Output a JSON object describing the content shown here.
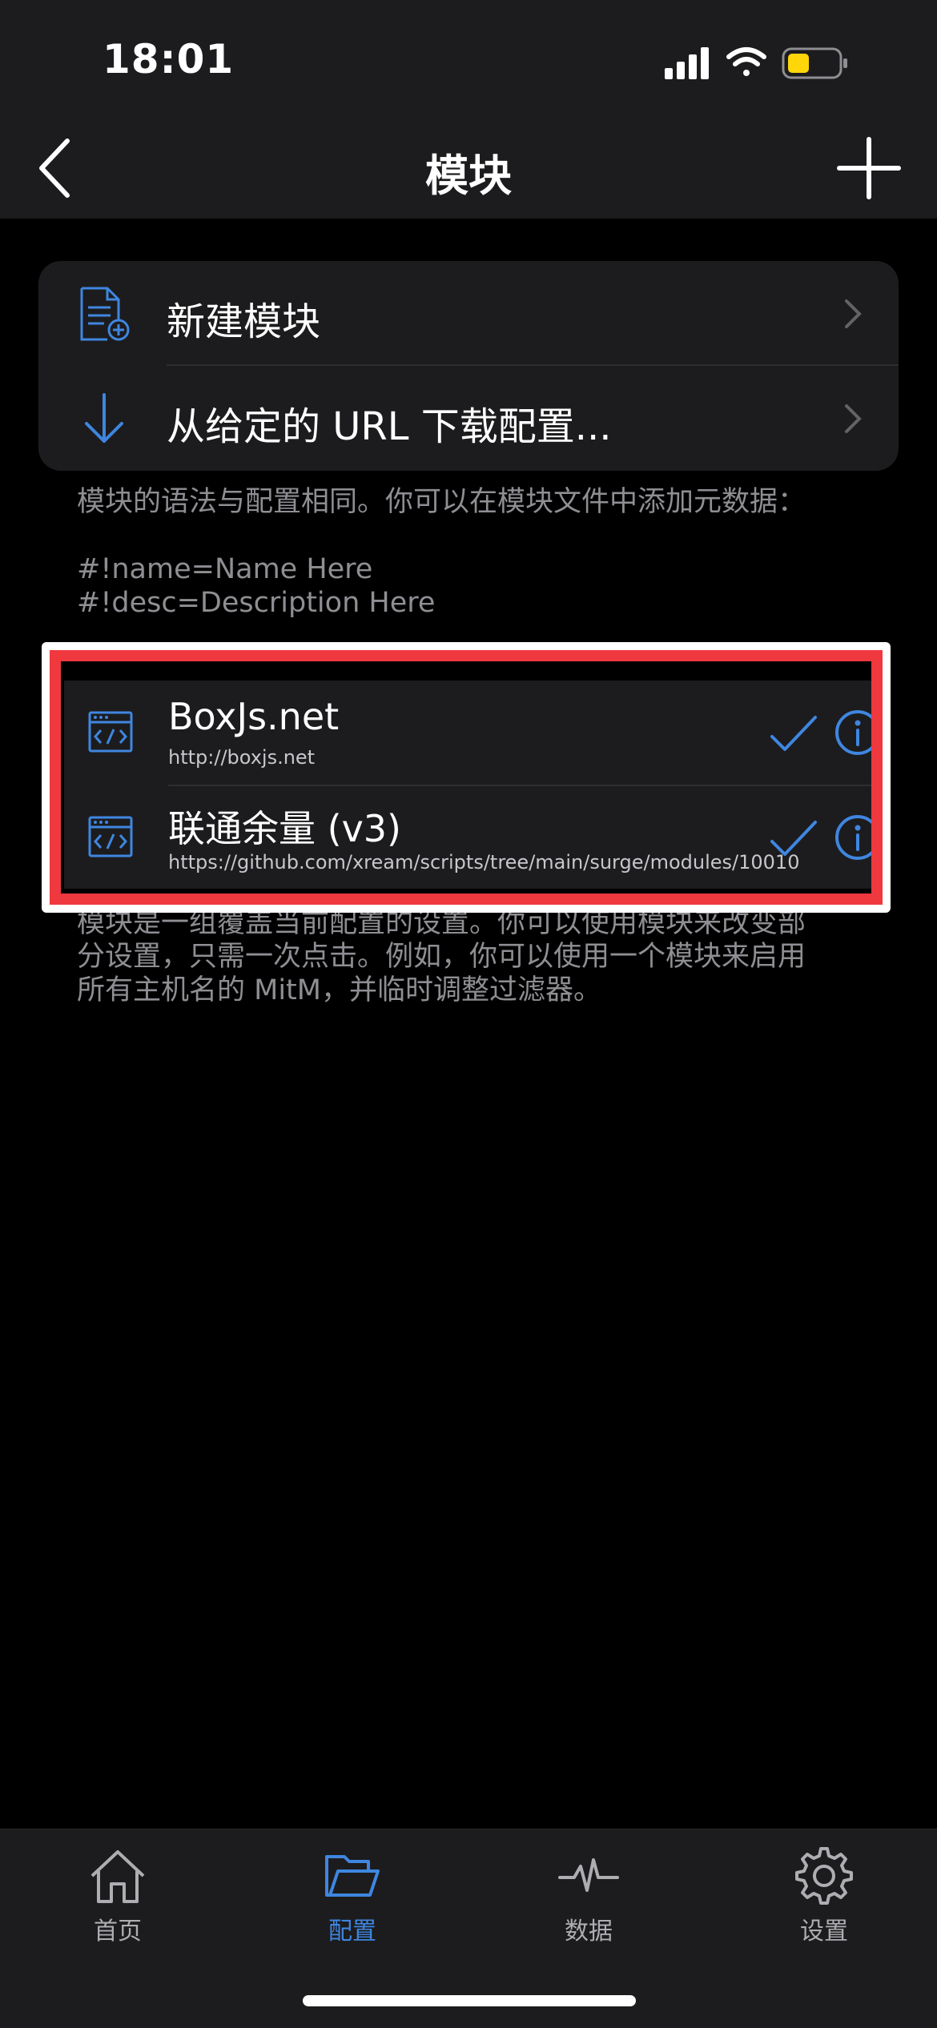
{
  "status": {
    "time": "18:01"
  },
  "nav": {
    "title": "模块"
  },
  "actions": [
    {
      "label": "新建模块",
      "icon": "new-document-icon"
    },
    {
      "label": "从给定的 URL 下载配置...",
      "icon": "download-arrow-icon"
    }
  ],
  "syntax_note": {
    "line1": "模块的语法与配置相同。你可以在模块文件中添加元数据：",
    "line2": "#!name=Name Here",
    "line3": "#!desc=Description Here"
  },
  "modules": [
    {
      "title": "BoxJs.net",
      "url": "http://boxjs.net",
      "enabled": true
    },
    {
      "title": "联通余量 (v3)",
      "url": "https://github.com/xream/scripts/tree/main/surge/modules/10010",
      "enabled": true
    }
  ],
  "modules_note": {
    "line1": "模块是一组覆盖当前配置的设置。你可以使用模块来改变部",
    "line2": "分设置，只需一次点击。例如，你可以使用一个模块来启用",
    "line3": "所有主机名的 MitM，并临时调整过滤器。"
  },
  "tabs": [
    {
      "label": "首页",
      "icon": "home-icon",
      "active": false
    },
    {
      "label": "配置",
      "icon": "folder-icon",
      "active": true
    },
    {
      "label": "数据",
      "icon": "activity-icon",
      "active": false
    },
    {
      "label": "设置",
      "icon": "gear-icon",
      "active": false
    }
  ],
  "colors": {
    "accent": "#3f86e0",
    "highlight": "#f0383f",
    "background": "#000000",
    "card": "#1c1c1e"
  }
}
